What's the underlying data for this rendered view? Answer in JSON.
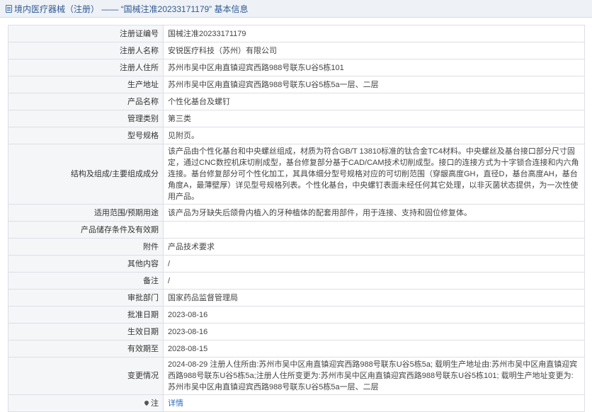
{
  "header": {
    "title": "境内医疗器械（注册） —— “国械注准20233171179” 基本信息"
  },
  "rows": [
    {
      "label": "注册证编号",
      "value": "国械注准20233171179"
    },
    {
      "label": "注册人名称",
      "value": "安锐医疗科技（苏州）有限公司"
    },
    {
      "label": "注册人住所",
      "value": "苏州市吴中区甪直镇迎宾西路988号联东U谷5栋101"
    },
    {
      "label": "生产地址",
      "value": "苏州市吴中区甪直镇迎宾西路988号联东U谷5栋5a一层、二层"
    },
    {
      "label": "产品名称",
      "value": "个性化基台及螺钉"
    },
    {
      "label": "管理类别",
      "value": "第三类"
    },
    {
      "label": "型号规格",
      "value": "见附页。"
    },
    {
      "label": "结构及组成/主要组成成分",
      "value": "该产品由个性化基台和中央螺丝组成，材质为符合GB/T 13810标准的钛合金TC4材料。中央螺丝及基台接口部分尺寸固定，通过CNC数控机床切削成型，基台修复部分基于CAD/CAM技术切削成型。接口的连接方式为十字锁合连接和内六角连接。基台修复部分可个性化加工，其具体细分型号规格对应的可切削范围（穿龈高度GH，直径D，基台高度AH，基台角度A，最薄壁厚）详见型号规格列表。个性化基台，中央螺钉表面未经任何其它处理，以非灭菌状态提供，为一次性使用产品。"
    },
    {
      "label": "适用范围/预期用途",
      "value": "该产品为牙缺失后颌骨内植入的牙种植体的配套用部件，用于连接、支持和固位修复体。"
    },
    {
      "label": "产品储存条件及有效期",
      "value": ""
    },
    {
      "label": "附件",
      "value": "产品技术要求"
    },
    {
      "label": "其他内容",
      "value": "/"
    },
    {
      "label": "备注",
      "value": "/"
    },
    {
      "label": "审批部门",
      "value": "国家药品监督管理局"
    },
    {
      "label": "批准日期",
      "value": "2023-08-16"
    },
    {
      "label": "生效日期",
      "value": "2023-08-16"
    },
    {
      "label": "有效期至",
      "value": "2028-08-15"
    },
    {
      "label": "变更情况",
      "value": "2024-08-29 注册人住所由:苏州市吴中区甪直镇迎宾西路988号联东U谷5栋5a; 载明生产地址由:苏州市吴中区甪直镇迎宾西路988号联东U谷5栋5a;注册人住所变更为:苏州市吴中区甪直镇迎宾西路988号联东U谷5栋101; 载明生产地址变更为:苏州市吴中区甪直镇迎宾西路988号联东U谷5栋5a一层、二层"
    }
  ],
  "note_row": {
    "label": "注",
    "link_text": "详情"
  }
}
